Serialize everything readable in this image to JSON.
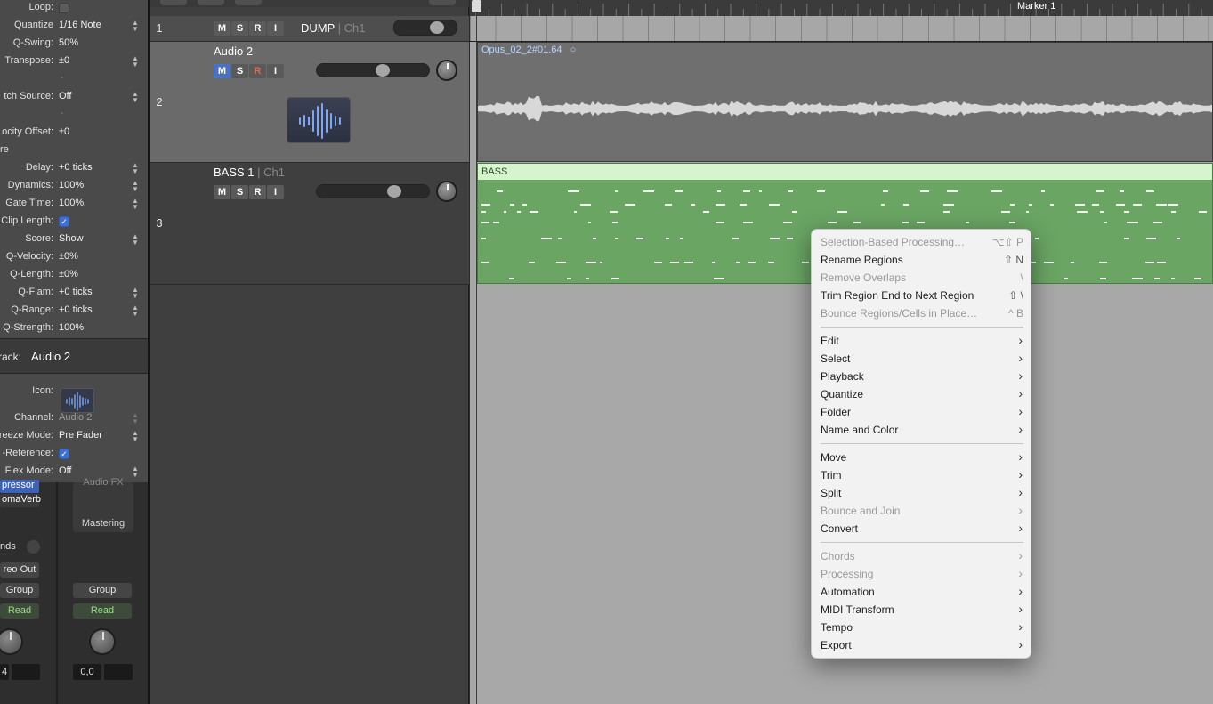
{
  "inspector": {
    "region_params": [
      {
        "label": "Loop:",
        "type": "checkbox",
        "checked": false
      },
      {
        "label": "Quantize",
        "value": "1/16 Note",
        "stepper": true
      },
      {
        "label": "Q-Swing:",
        "value": "50%"
      },
      {
        "label": "Transpose:",
        "value": "±0",
        "stepper": true
      },
      {
        "label": "",
        "value": "-"
      },
      {
        "label": "tch Source:",
        "value": "Off",
        "stepper": true
      },
      {
        "label": "",
        "value": "-"
      },
      {
        "label": "ocity Offset:",
        "value": "±0"
      },
      {
        "label": "re",
        "value": ""
      },
      {
        "label": "Delay:",
        "value": "+0 ticks",
        "stepper": true
      },
      {
        "label": "Dynamics:",
        "value": "100%",
        "stepper": true
      },
      {
        "label": "Gate Time:",
        "value": "100%",
        "stepper": true
      },
      {
        "label": "Clip Length:",
        "type": "checkbox",
        "checked": true
      },
      {
        "label": "Score:",
        "value": "Show",
        "stepper": true
      },
      {
        "label": "Q-Velocity:",
        "value": "±0%"
      },
      {
        "label": "Q-Length:",
        "value": "±0%"
      },
      {
        "label": "Q-Flam:",
        "value": "+0 ticks",
        "stepper": true
      },
      {
        "label": "Q-Range:",
        "value": "+0 ticks",
        "stepper": true
      },
      {
        "label": "Q-Strength:",
        "value": "100%"
      }
    ],
    "track_label": "rack:",
    "track_name": "Audio 2",
    "track_params": {
      "icon_label": "Icon:",
      "channel_label": "Channel:",
      "channel_value": "Audio 2",
      "freeze_label": "reeze Mode:",
      "freeze_value": "Pre Fader",
      "reference_label": "-Reference:",
      "flex_label": "Flex Mode:",
      "flex_value": "Off"
    },
    "mixer": {
      "plugin1": "pressor",
      "plugin2": "omaVerb",
      "slot_label": "Audio FX",
      "slot_name": "Mastering",
      "sends_label": "nds",
      "output_label": "reo Out",
      "group_left": "Group",
      "group_right": "Group",
      "read_left": "Read",
      "read_right": "Read",
      "value_left": "4",
      "value_right": "0,0"
    }
  },
  "tracks": [
    {
      "number": "1",
      "name": "DUMP",
      "channel": "Ch1",
      "buttons": [
        "M",
        "S",
        "R",
        "I"
      ]
    },
    {
      "number": "2",
      "name": "Audio 2",
      "channel": "",
      "buttons": [
        "M",
        "S",
        "R",
        "I"
      ],
      "mute_on": true,
      "fader_level": 0.6
    },
    {
      "number": "3",
      "name": "BASS 1",
      "channel": "Ch1",
      "buttons": [
        "M",
        "S",
        "R",
        "I"
      ],
      "fader_level": 0.72
    }
  ],
  "arrange": {
    "marker": "Marker 1",
    "audio_region": "Opus_02_2#01.64",
    "midi_region": "BASS"
  },
  "context_menu": {
    "group1": [
      {
        "label": "Selection-Based Processing…",
        "shortcut": "⌥⇧ P",
        "disabled": true
      },
      {
        "label": "Rename Regions",
        "shortcut": "⇧ N",
        "disabled": false
      },
      {
        "label": "Remove Overlaps",
        "shortcut": "\\",
        "disabled": true
      },
      {
        "label": "Trim Region End to Next Region",
        "shortcut": "⇧ \\",
        "disabled": false
      },
      {
        "label": "Bounce Regions/Cells in Place…",
        "shortcut": "^ B",
        "disabled": true
      }
    ],
    "group2": [
      {
        "label": "Edit",
        "disabled": false
      },
      {
        "label": "Select",
        "disabled": false
      },
      {
        "label": "Playback",
        "disabled": false
      },
      {
        "label": "Quantize",
        "disabled": false
      },
      {
        "label": "Folder",
        "disabled": false
      },
      {
        "label": "Name and Color",
        "disabled": false
      }
    ],
    "group3": [
      {
        "label": "Move",
        "disabled": false
      },
      {
        "label": "Trim",
        "disabled": false
      },
      {
        "label": "Split",
        "disabled": false
      },
      {
        "label": "Bounce and Join",
        "disabled": true
      },
      {
        "label": "Convert",
        "disabled": false
      }
    ],
    "group4": [
      {
        "label": "Chords",
        "disabled": true
      },
      {
        "label": "Processing",
        "disabled": true
      },
      {
        "label": "Automation",
        "disabled": false
      },
      {
        "label": "MIDI Transform",
        "disabled": false
      },
      {
        "label": "Tempo",
        "disabled": false
      },
      {
        "label": "Export",
        "disabled": false
      }
    ]
  }
}
